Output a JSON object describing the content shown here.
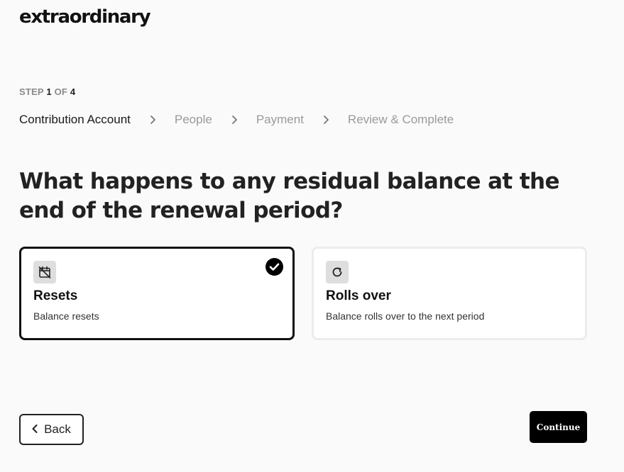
{
  "brand": {
    "logo_text": "extraordinary"
  },
  "progress": {
    "step_prefix": "STEP",
    "current_step": "1",
    "step_of": "OF",
    "total_steps": "4"
  },
  "breadcrumb": [
    {
      "label": "Contribution Account",
      "active": true
    },
    {
      "label": "People",
      "active": false
    },
    {
      "label": "Payment",
      "active": false
    },
    {
      "label": "Review & Complete",
      "active": false
    }
  ],
  "question": "What happens to any residual balance at the end of the renewal period?",
  "options": [
    {
      "title": "Resets",
      "description": "Balance resets",
      "icon": "calendar-reset-icon",
      "selected": true
    },
    {
      "title": "Rolls over",
      "description": "Balance rolls over to the next period",
      "icon": "refresh-icon",
      "selected": false
    }
  ],
  "actions": {
    "back_label": "Back",
    "continue_label": "Continue"
  },
  "colors": {
    "accent": "#000000",
    "selected_border": "#111111",
    "unselected_border": "#ececec",
    "muted_text": "#9a9a9a"
  }
}
